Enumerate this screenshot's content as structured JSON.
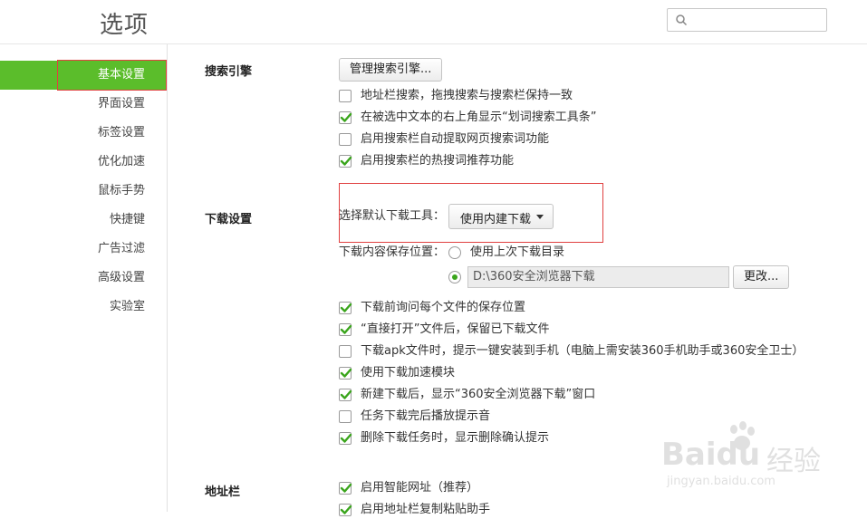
{
  "header": {
    "title": "选项",
    "search": {
      "placeholder": "",
      "value": ""
    }
  },
  "sidebar": {
    "items": [
      {
        "label": "基本设置",
        "active": true
      },
      {
        "label": "界面设置"
      },
      {
        "label": "标签设置"
      },
      {
        "label": "优化加速"
      },
      {
        "label": "鼠标手势"
      },
      {
        "label": "快捷键"
      },
      {
        "label": "广告过滤"
      },
      {
        "label": "高级设置"
      },
      {
        "label": "实验室"
      }
    ]
  },
  "search_engine": {
    "title": "搜索引擎",
    "manage_button": "管理搜索引擎...",
    "options": [
      {
        "label": "地址栏搜索，拖拽搜索与搜索栏保持一致",
        "checked": false
      },
      {
        "label": "在被选中文本的右上角显示“划词搜索工具条”",
        "checked": true
      },
      {
        "label": "启用搜索栏自动提取网页搜索词功能",
        "checked": false
      },
      {
        "label": "启用搜索栏的热搜词推荐功能",
        "checked": true
      }
    ]
  },
  "download": {
    "title": "下载设置",
    "default_tool_label": "选择默认下载工具：",
    "default_tool_value": "使用内建下载",
    "save_location_label": "下载内容保存位置：",
    "radio_last_dir": {
      "label": "使用上次下载目录",
      "selected": false
    },
    "radio_custom": {
      "selected": true,
      "path": "D:\\360安全浏览器下载"
    },
    "change_button": "更改...",
    "options": [
      {
        "label": "下载前询问每个文件的保存位置",
        "checked": true
      },
      {
        "label": "“直接打开”文件后，保留已下载文件",
        "checked": true
      },
      {
        "label": "下载apk文件时，提示一键安装到手机（电脑上需安装360手机助手或360安全卫士）",
        "checked": false
      },
      {
        "label": "使用下载加速模块",
        "checked": true
      },
      {
        "label": "新建下载后，显示“360安全浏览器下载”窗口",
        "checked": true
      },
      {
        "label": "任务下载完后播放提示音",
        "checked": false
      },
      {
        "label": "删除下载任务时，显示删除确认提示",
        "checked": true
      }
    ]
  },
  "address_bar": {
    "title": "地址栏",
    "options": [
      {
        "label": "启用智能网址（推荐）",
        "checked": true
      },
      {
        "label": "启用地址栏复制粘贴助手",
        "checked": true
      }
    ]
  },
  "watermark": {
    "brand": "Baidu",
    "brand_cn": "经验",
    "url": "jingyan.baidu.com"
  },
  "colors": {
    "accent": "#5bbd2b",
    "checkmark": "#3aa51c",
    "highlight_outline": "#e04040"
  }
}
